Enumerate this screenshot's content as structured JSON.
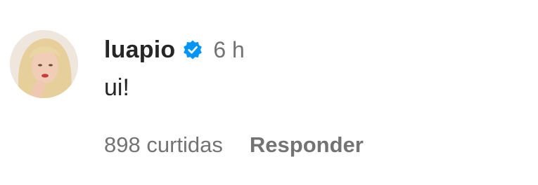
{
  "comment": {
    "username": "luapio",
    "verified_icon": "verified-badge-icon",
    "time": "6 h",
    "text": "ui!",
    "likes": "898 curtidas",
    "reply_label": "Responder"
  },
  "colors": {
    "primary_text": "#262626",
    "secondary_text": "#737373",
    "verified_blue": "#0095f6",
    "background": "#ffffff"
  }
}
